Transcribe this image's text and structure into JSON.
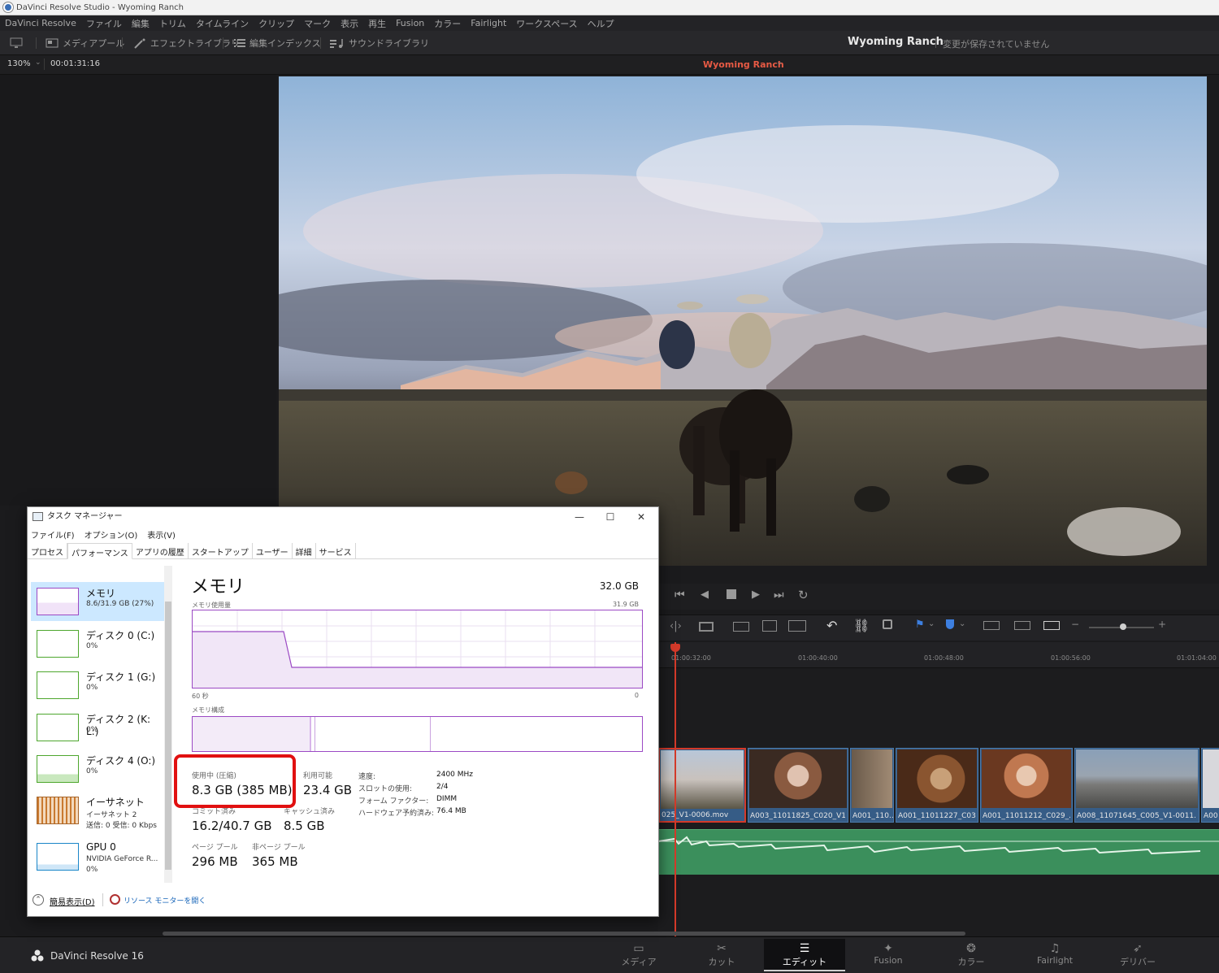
{
  "app": {
    "window_title": "DaVinci Resolve Studio - Wyoming Ranch",
    "menu": [
      "DaVinci Resolve",
      "ファイル",
      "編集",
      "トリム",
      "タイムライン",
      "クリップ",
      "マーク",
      "表示",
      "再生",
      "Fusion",
      "カラー",
      "Fairlight",
      "ワークスペース",
      "ヘルプ"
    ],
    "toolbar": {
      "media_pool": "メディアプール",
      "effects_library": "エフェクトライブラリ",
      "edit_index": "編集インデックス",
      "sound_library": "サウンドライブラリ"
    },
    "project_title": "Wyoming Ranch",
    "project_status": "変更が保存されていません",
    "viewer": {
      "zoom": "130%",
      "timecode": "00:01:31:16",
      "timeline_name": "Wyoming Ranch"
    },
    "ruler_ticks": [
      "01:00:32:00",
      "01:00:40:00",
      "01:00:48:00",
      "01:00:56:00",
      "01:01:04:00"
    ],
    "clips": [
      "025_V1-0006.mov",
      "A003_11011825_C020_V1...",
      "A001_110...",
      "A001_11011227_C03...",
      "A001_11011212_C029_...",
      "A008_11071645_C005_V1-0011...",
      "A00"
    ],
    "brand": "DaVinci Resolve 16",
    "pages": [
      "メディア",
      "カット",
      "エディット",
      "Fusion",
      "カラー",
      "Fairlight",
      "デリバー"
    ],
    "active_page": "エディット"
  },
  "taskmanager": {
    "title": "タスク マネージャー",
    "menu": [
      "ファイル(F)",
      "オプション(O)",
      "表示(V)"
    ],
    "tabs": [
      "プロセス",
      "パフォーマンス",
      "アプリの履歴",
      "スタートアップ",
      "ユーザー",
      "詳細",
      "サービス"
    ],
    "active_tab": "パフォーマンス",
    "resources": [
      {
        "name": "メモリ",
        "sub": "8.6/31.9 GB (27%)",
        "sub2": ""
      },
      {
        "name": "ディスク 0 (C:)",
        "sub": "0%",
        "sub2": ""
      },
      {
        "name": "ディスク 1 (G:)",
        "sub": "0%",
        "sub2": ""
      },
      {
        "name": "ディスク 2 (K: L:)",
        "sub": "0%",
        "sub2": ""
      },
      {
        "name": "ディスク 4 (O:)",
        "sub": "0%",
        "sub2": ""
      },
      {
        "name": "イーサネット",
        "sub": "イーサネット 2",
        "sub2": "送信: 0 受信: 0 Kbps"
      },
      {
        "name": "GPU 0",
        "sub": "NVIDIA GeForce R...",
        "sub2": "0%"
      }
    ],
    "memory": {
      "heading": "メモリ",
      "total": "32.0 GB",
      "usage_label": "メモリ使用量",
      "usage_max": "31.9 GB",
      "time_left": "60 秒",
      "time_right": "0",
      "composition_label": "メモリ構成",
      "in_use_label": "使用中 (圧縮)",
      "in_use_value": "8.3 GB (385 MB)",
      "available_label": "利用可能",
      "available_value": "23.4 GB",
      "committed_label": "コミット済み",
      "committed_value": "16.2/40.7 GB",
      "cached_label": "キャッシュ済み",
      "cached_value": "8.5 GB",
      "paged_label": "ページ プール",
      "paged_value": "296 MB",
      "nonpaged_label": "非ページ プール",
      "nonpaged_value": "365 MB",
      "speed_label": "速度:",
      "speed_value": "2400 MHz",
      "slots_label": "スロットの使用:",
      "slots_value": "2/4",
      "form_label": "フォーム ファクター:",
      "form_value": "DIMM",
      "reserved_label": "ハードウェア予約済み:",
      "reserved_value": "76.4 MB"
    },
    "footer": {
      "simple": "簡易表示(D)",
      "monitor": "リソース モニターを開く"
    }
  }
}
